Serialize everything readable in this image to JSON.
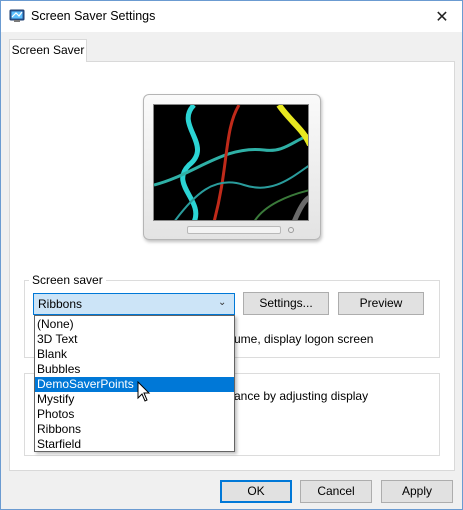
{
  "window": {
    "title": "Screen Saver Settings",
    "close_glyph": "✕"
  },
  "tabs": [
    {
      "label": "Screen Saver"
    }
  ],
  "screen_saver": {
    "group_label": "Screen saver",
    "selected": "Ribbons",
    "settings_label": "Settings...",
    "preview_label": "Preview",
    "resume_text_partial": "ume, display logon screen",
    "options": [
      {
        "label": "(None)"
      },
      {
        "label": "3D Text"
      },
      {
        "label": "Blank"
      },
      {
        "label": "Bubbles"
      },
      {
        "label": "DemoSaverPoints",
        "highlighted": true
      },
      {
        "label": "Mystify"
      },
      {
        "label": "Photos"
      },
      {
        "label": "Ribbons"
      },
      {
        "label": "Starfield"
      }
    ]
  },
  "power": {
    "text_partial": "ance by adjusting display"
  },
  "footer": {
    "ok_label": "OK",
    "cancel_label": "Cancel",
    "apply_label": "Apply"
  },
  "colors": {
    "accent": "#0078d7",
    "selection_bg": "#cce4f7"
  }
}
